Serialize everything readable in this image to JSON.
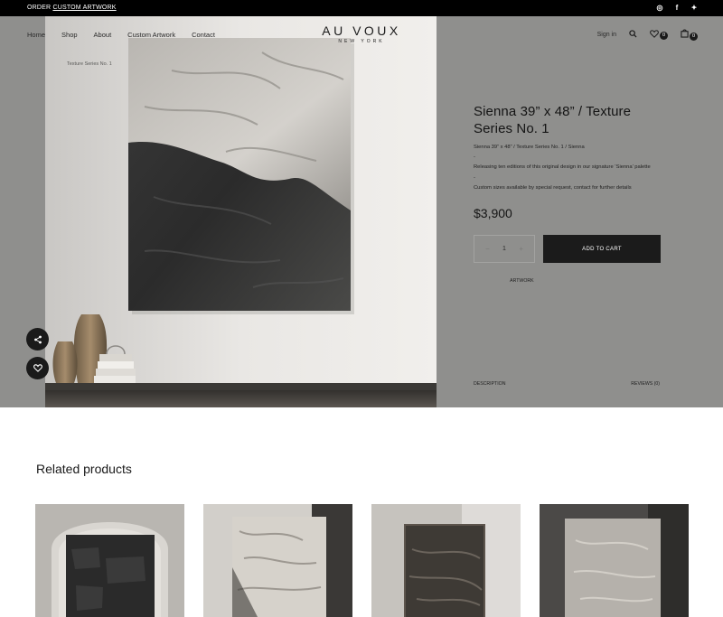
{
  "topbar": {
    "promo_prefix": "ORDER",
    "promo_link": "CUSTOM ARTWORK",
    "social": [
      {
        "icon": "instagram-icon",
        "glyph": "◎"
      },
      {
        "icon": "facebook-icon",
        "glyph": "f"
      },
      {
        "icon": "twitter-icon",
        "glyph": "✦"
      }
    ]
  },
  "nav": {
    "links": [
      "Home",
      "Shop",
      "About",
      "Custom Artwork",
      "Contact"
    ],
    "logo_main": "AU VOUX",
    "logo_sub": "NEW YORK",
    "signin": "Sign in",
    "wishlist_count": "0",
    "cart_count": "0"
  },
  "breadcrumb": {
    "current": "Texture Series No. 1"
  },
  "product": {
    "title": "Sienna 39” x 48” / Texture Series No. 1",
    "desc_lines": [
      "Sienna 39” x 48” / Texture Series No. 1 / Sienna",
      "-",
      "Releasing ten editions of this original design in our signature ‘Sienna’ palette",
      "-",
      "Custom sizes available by special request, contact for further details"
    ],
    "price": "$3,900",
    "quantity": "1",
    "minus": "−",
    "plus": "+",
    "add_to_cart": "ADD TO CART",
    "category": "ARTWORK"
  },
  "tabs": {
    "description": "DESCRIPTION",
    "reviews": "REVIEWS (0)"
  },
  "related": {
    "title": "Related products"
  },
  "colors": {
    "overlay": "#8f8f8d",
    "accent": "#1b1b1b",
    "topbar": "#000000"
  }
}
